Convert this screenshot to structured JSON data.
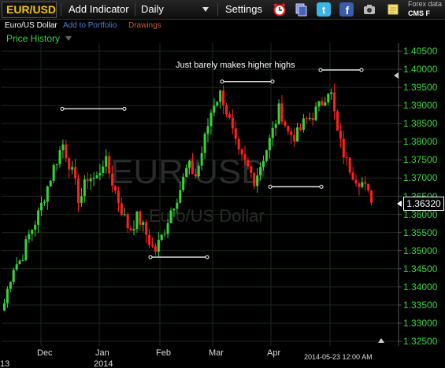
{
  "toolbar": {
    "symbol": "EUR/USD",
    "add_indicator": "Add Indicator",
    "interval": "Daily",
    "settings": "Settings",
    "forex_data": "Forex data",
    "provider": "CMS F"
  },
  "subbar": {
    "instrument_name": "Euro/US Dollar",
    "add_to_portfolio": "Add to Portfolio",
    "drawings": "Drawings",
    "panel": "Price History"
  },
  "watermark": {
    "symbol": "EUR/USD",
    "name": "Euro/US Dollar"
  },
  "annotation": "Just barely makes higher highs",
  "timestamp": "2014-05-23 12:00 AM",
  "current_price": "1.36320",
  "left_edge_label": "13",
  "colors": {
    "up": "#38d33a",
    "down": "#ff2020",
    "symbol": "#f0c419",
    "axis_text": "#39d63f"
  },
  "chart_data": {
    "type": "candlestick",
    "instrument": "EUR/USD",
    "timeframe": "Daily",
    "ylim": [
      1.325,
      1.405
    ],
    "yticks": [
      "1.40500",
      "1.40000",
      "1.39500",
      "1.39000",
      "1.38500",
      "1.38000",
      "1.37500",
      "1.37000",
      "1.36500",
      "1.36000",
      "1.35500",
      "1.35000",
      "1.34500",
      "1.34000",
      "1.33500",
      "1.33000",
      "1.32500"
    ],
    "x_labels": [
      "Dec",
      "Jan",
      "Feb",
      "Mar",
      "Apr"
    ],
    "year_label": "2014",
    "last_close": 1.3632,
    "close_path": [
      1.3355,
      1.3455,
      1.3475,
      1.3545,
      1.3595,
      1.3665,
      1.3735,
      1.3795,
      1.3725,
      1.3635,
      1.3705,
      1.3695,
      1.3755,
      1.3685,
      1.3615,
      1.3555,
      1.3595,
      1.3545,
      1.3495,
      1.3545,
      1.3615,
      1.3665,
      1.3735,
      1.3705,
      1.3805,
      1.3905,
      1.3935,
      1.3855,
      1.3765,
      1.3735,
      1.3695,
      1.3755,
      1.3815,
      1.3895,
      1.3825,
      1.3815,
      1.3855,
      1.3875,
      1.3905,
      1.3955,
      1.3815,
      1.3745,
      1.3705,
      1.3685,
      1.3632
    ],
    "annotations": [
      {
        "type": "resistance",
        "level": 1.3891,
        "period": "Dec"
      },
      {
        "type": "support",
        "level": 1.3482,
        "period": "Feb"
      },
      {
        "type": "resistance",
        "level": 1.3966,
        "period": "Mar"
      },
      {
        "type": "support",
        "level": 1.3676,
        "period": "Apr"
      },
      {
        "type": "resistance",
        "level": 1.3998,
        "period": "May"
      }
    ]
  }
}
